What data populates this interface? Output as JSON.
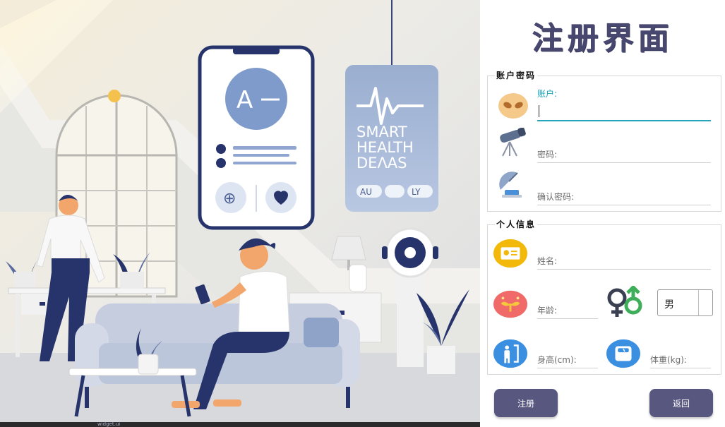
{
  "illustration": {
    "phone_badge_text": "A",
    "card_text_line1": "SMART",
    "card_text_line2": "HEALTH",
    "card_text_line3": "DEΛAS",
    "card_chip_1": "AU",
    "card_chip_2": "LY"
  },
  "taskbar": {
    "fragment_text": "widget.ui"
  },
  "panel": {
    "title": "注册界面",
    "account_group": {
      "title": "账户密码",
      "account_label": "账户:",
      "account_value": "",
      "password_label": "密码:",
      "confirm_label": "确认密码:"
    },
    "personal_group": {
      "title": "个人信息",
      "name_label": "姓名:",
      "age_label": "年龄:",
      "gender_selected": "男",
      "height_label": "身高(cm):",
      "weight_label": "体重(kg):"
    },
    "buttons": {
      "register": "注册",
      "back": "返回"
    }
  },
  "colors": {
    "title": "#474770",
    "button": "#575780",
    "active_field": "#26a5bd"
  },
  "icons": [
    "alien-face-icon",
    "telescope-icon",
    "satellite-dish-icon",
    "id-card-icon",
    "seedling-icon",
    "gender-icon",
    "person-height-icon",
    "scale-icon"
  ]
}
